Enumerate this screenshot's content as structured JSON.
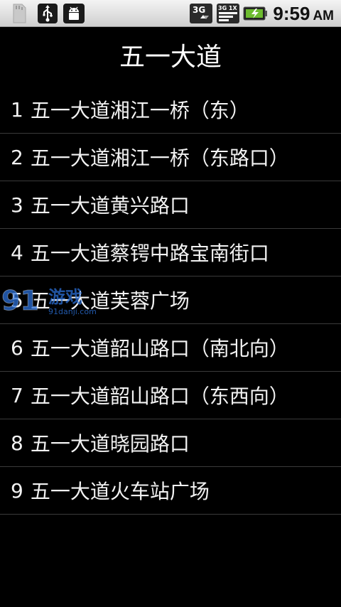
{
  "status_bar": {
    "icons": [
      "sd-card-icon",
      "usb-icon",
      "android-debug-icon",
      "network-3g-icon",
      "signal-icon",
      "battery-charging-icon"
    ],
    "net_label": "3G",
    "signal_label": "3G 1X",
    "time": "9:59",
    "ampm": "AM"
  },
  "header": {
    "title": "五一大道"
  },
  "stops": [
    {
      "number": "1",
      "name": "五一大道湘江一桥（东）"
    },
    {
      "number": "2",
      "name": "五一大道湘江一桥（东路口）"
    },
    {
      "number": "3",
      "name": "五一大道黄兴路口"
    },
    {
      "number": "4",
      "name": "五一大道蔡锷中路宝南街口"
    },
    {
      "number": "5",
      "name": "五一大道芙蓉广场"
    },
    {
      "number": "6",
      "name": "五一大道韶山路口（南北向）"
    },
    {
      "number": "7",
      "name": "五一大道韶山路口（东西向）"
    },
    {
      "number": "8",
      "name": "五一大道晓园路口"
    },
    {
      "number": "9",
      "name": "五一大道火车站广场"
    }
  ],
  "watermark": {
    "brand": "91",
    "text": "游戏",
    "site": "91danji.com"
  },
  "colors": {
    "background": "#000000",
    "text": "#f2f2f2",
    "divider": "#3a3a3a",
    "statusbar": "#dcdcdc",
    "watermark": "#2b6fd6"
  }
}
